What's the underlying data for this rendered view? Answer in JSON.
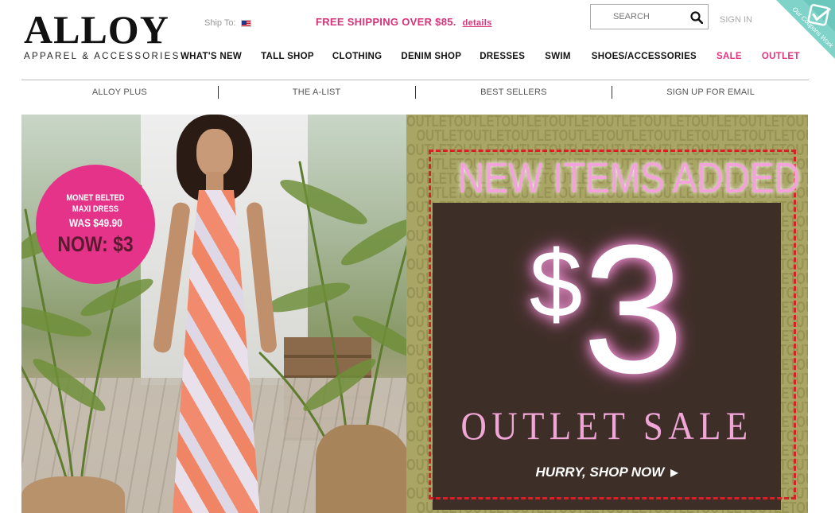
{
  "header": {
    "logo_main": "ALLOY",
    "logo_sub": "APPAREL & ACCESSORIES",
    "ship_to_label": "Ship To:",
    "promo_text": "FREE SHIPPING OVER $85.",
    "promo_link": "details",
    "search_placeholder": "SEARCH",
    "sign_in": "SIGN IN",
    "coupon_line1": "Our Coupons Work",
    "coupon_line2": "GUARANTEED"
  },
  "main_nav": [
    {
      "label": "WHAT'S NEW"
    },
    {
      "label": "TALL SHOP"
    },
    {
      "label": "CLOTHING"
    },
    {
      "label": "DENIM SHOP"
    },
    {
      "label": "DRESSES"
    },
    {
      "label": "SWIM"
    },
    {
      "label": "SHOES/ACCESSORIES"
    },
    {
      "label": "SALE"
    },
    {
      "label": "OUTLET"
    }
  ],
  "sub_nav": [
    {
      "label": "ALLOY PLUS"
    },
    {
      "label": "THE A-LIST"
    },
    {
      "label": "BEST SELLERS"
    },
    {
      "label": "SIGN UP FOR EMAIL"
    }
  ],
  "hero_left": {
    "product_name": "MONET BELTED MAXI DRESS",
    "was_price": "WAS $49.90",
    "now_price": "NOW: $3"
  },
  "hero_right": {
    "pattern_word": "OUTLET",
    "headline": "NEW ITEMS ADDED",
    "dollar": "$",
    "amount": "3",
    "sale_text": "OUTLET SALE",
    "cta": "HURRY, SHOP NOW",
    "cta_arrow": "▶"
  },
  "colors": {
    "accent_pink": "#e0337f",
    "promo_circle": "#e6338a",
    "outlet_bg": "#a9a665",
    "panel_brown": "#3e2e28",
    "frame_red": "#d82026",
    "ribbon_teal": "#7fd3c8"
  },
  "icons": {
    "search": "search-icon",
    "flag": "us-flag-icon",
    "arrow": "play-arrow-icon",
    "check": "checkmark-icon"
  }
}
